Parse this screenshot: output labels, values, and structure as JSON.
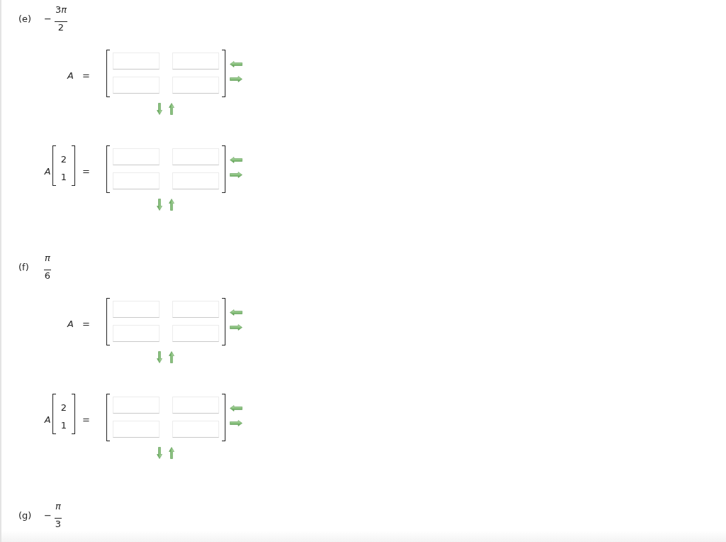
{
  "parts": [
    {
      "label": "(e)",
      "value": {
        "sign": "−",
        "numerator": {
          "coefficient": "3",
          "symbol": "π"
        },
        "denominator": "2"
      },
      "equations": [
        {
          "lhs": {
            "matrix": "A"
          },
          "equals": "=",
          "answer": {
            "rows": [
              {
                "cells": [
                  {
                    "kind": "blank"
                  },
                  {
                    "kind": "blank"
                  }
                ]
              },
              {
                "cells": [
                  {
                    "kind": "blank"
                  },
                  {
                    "kind": "blank"
                  }
                ]
              }
            ]
          }
        },
        {
          "lhs": {
            "matrix": "A",
            "vector": [
              "2",
              "1"
            ]
          },
          "equals": "=",
          "answer": {
            "rows": [
              {
                "cells": [
                  {
                    "kind": "blank"
                  },
                  {
                    "kind": "blank"
                  }
                ]
              },
              {
                "cells": [
                  {
                    "kind": "blank"
                  },
                  {
                    "kind": "blank"
                  }
                ]
              }
            ]
          }
        }
      ]
    },
    {
      "label": "(f)",
      "value": {
        "numerator": {
          "symbol": "π"
        },
        "denominator": "6"
      },
      "equations": [
        {
          "lhs": {
            "matrix": "A"
          },
          "equals": "=",
          "answer": {
            "rows": [
              {
                "cells": [
                  {
                    "kind": "blank"
                  },
                  {
                    "kind": "blank"
                  }
                ]
              },
              {
                "cells": [
                  {
                    "kind": "blank"
                  },
                  {
                    "kind": "blank"
                  }
                ]
              }
            ]
          }
        },
        {
          "lhs": {
            "matrix": "A",
            "vector": [
              "2",
              "1"
            ]
          },
          "equals": "=",
          "answer": {
            "rows": [
              {
                "cells": [
                  {
                    "kind": "blank"
                  },
                  {
                    "kind": "blank"
                  }
                ]
              },
              {
                "cells": [
                  {
                    "kind": "blank"
                  },
                  {
                    "kind": "blank"
                  }
                ]
              }
            ]
          }
        }
      ]
    },
    {
      "label": "(g)",
      "value": {
        "sign": "−",
        "numerator": {
          "symbol": "π"
        },
        "denominator": "3"
      }
    }
  ]
}
